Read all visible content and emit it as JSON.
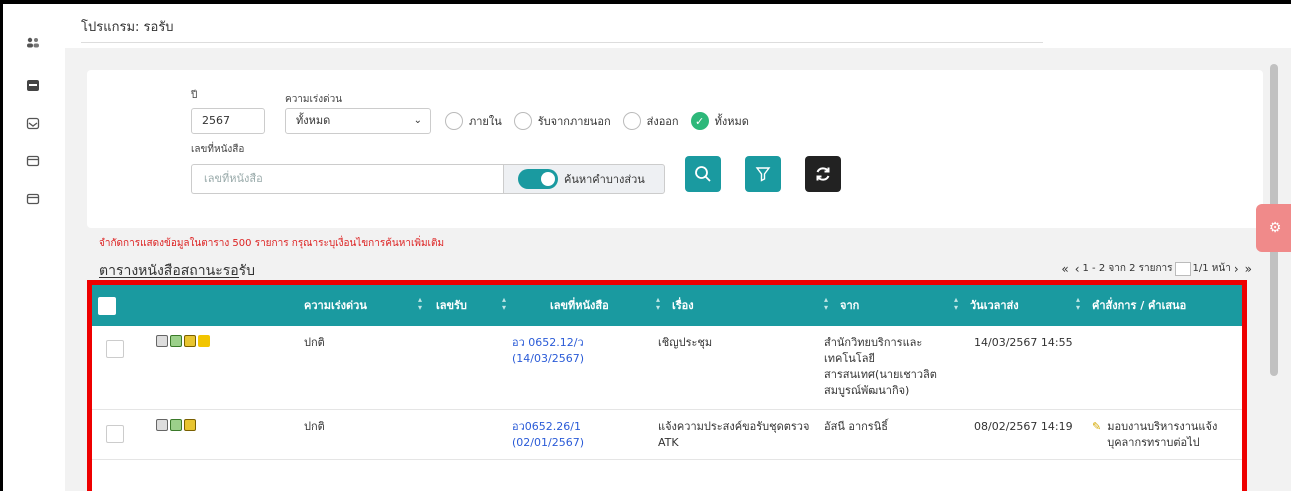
{
  "page": {
    "title": "โปรแกรม: รอรับ"
  },
  "filters": {
    "year_label": "ปี",
    "year_value": "2567",
    "urgency_label": "ความเร่งด่วน",
    "urgency_value": "ทั้งหมด",
    "scope_options": [
      {
        "label": "ภายใน",
        "selected": false
      },
      {
        "label": "รับจากภายนอก",
        "selected": false
      },
      {
        "label": "ส่งออก",
        "selected": false
      },
      {
        "label": "ทั้งหมด",
        "selected": true
      }
    ],
    "docno_label": "เลขที่หนังสือ",
    "docno_placeholder": "เลขที่หนังสือ",
    "partial_search_label": "ค้นหาคำบางส่วน",
    "partial_search_on": true
  },
  "notice": "จำกัดการแสดงข้อมูลในตาราง 500 รายการ กรุณาระบุเงื่อนไขการค้นหาเพิ่มเติม",
  "table": {
    "heading": "ตารางหนังสือสถานะรอรับ",
    "pager": {
      "first": "«",
      "prev": "‹",
      "summary": "1 - 2 จาก 2 รายการ",
      "page_suffix": "1/1 หน้า",
      "next": "›",
      "last": "»"
    },
    "columns": [
      "ความเร่งด่วน",
      "เลขรับ",
      "เลขที่หนังสือ",
      "เรื่อง",
      "จาก",
      "วันเวลาส่ง",
      "คำสั่งการ / คำเสนอ"
    ],
    "rows": [
      {
        "urgency": "ปกติ",
        "receive_no": "",
        "doc_no": "อว 0652.12/ว",
        "doc_date": "(14/03/2567)",
        "subject": "เชิญประชุม",
        "from_lines": [
          "สำนักวิทยบริการและ",
          "เทคโนโลยี",
          "สารสนเทศ(นายเชาวลิต",
          "สมบูรณ์พัฒนากิจ)"
        ],
        "sent_at": "14/03/2567 14:55",
        "order": ""
      },
      {
        "urgency": "ปกติ",
        "receive_no": "",
        "doc_no": "อว0652.26/1",
        "doc_date": "(02/01/2567)",
        "subject_lines": [
          "แจ้งความประสงค์ขอรับชุดตรวจ",
          "ATK"
        ],
        "from_lines": [
          "อัสนี อากรนิธิ์"
        ],
        "sent_at": "08/02/2567 14:19",
        "order_lines": [
          "มอบงานบริหารงานแจ้ง",
          "บุคลากรทราบต่อไป"
        ]
      }
    ]
  },
  "colors": {
    "accent": "#1a9aa0",
    "highlight": "#e00000",
    "notice": "#dd2222"
  }
}
